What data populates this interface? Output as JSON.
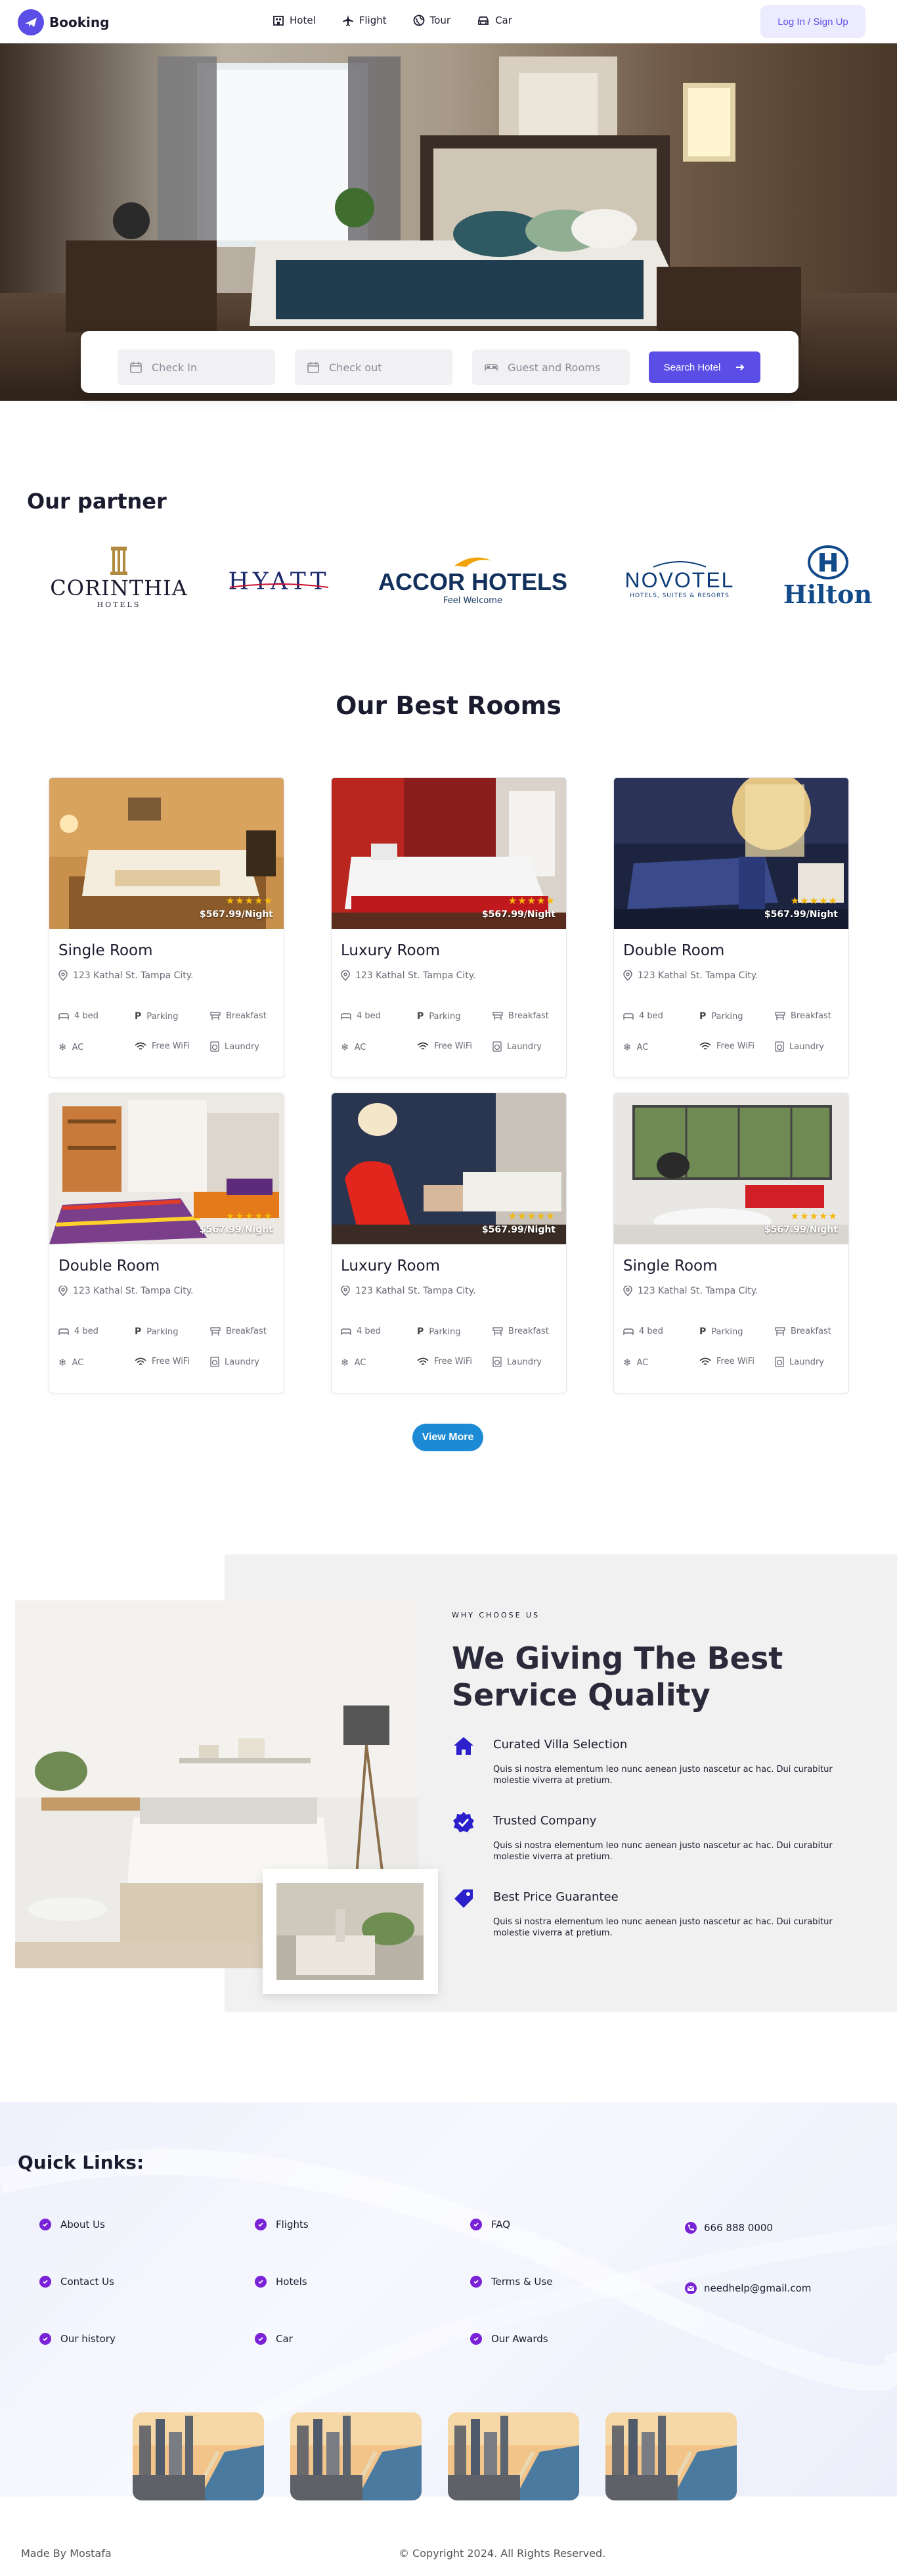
{
  "nav": {
    "brand": "Booking",
    "links": [
      {
        "label": "Hotel",
        "icon": "hotel-icon"
      },
      {
        "label": "Flight",
        "icon": "plane-icon"
      },
      {
        "label": "Tour",
        "icon": "globe-icon"
      },
      {
        "label": "Car",
        "icon": "car-icon"
      }
    ],
    "login_label": "Log In / Sign Up"
  },
  "search": {
    "check_in": "Check In",
    "check_out": "Check out",
    "guests": "Guest and Rooms",
    "button": "Search Hotel"
  },
  "partners": {
    "title": "Our partner",
    "logos": [
      {
        "name": "CORINTHIA",
        "sub": "HOTELS"
      },
      {
        "name": "HYATT",
        "sub": ""
      },
      {
        "name": "ACCOR HOTELS",
        "sub": "Feel Welcome"
      },
      {
        "name": "NOVOTEL",
        "sub": "HOTELS, SUITES & RESORTS"
      },
      {
        "name": "Hilton",
        "sub": ""
      }
    ]
  },
  "rooms": {
    "title": "Our Best Rooms",
    "view_more": "View More",
    "items": [
      {
        "title": "Single Room",
        "price": "$567.99/Night",
        "stars": "★★★★★",
        "address": "123 Kathal St. Tampa City.",
        "amenities": [
          "4 bed",
          "Parking",
          "Breakfast",
          "AC",
          "Free WiFi",
          "Laundry"
        ]
      },
      {
        "title": "Luxury Room",
        "price": "$567.99/Night",
        "stars": "★★★★★",
        "address": "123 Kathal St. Tampa City.",
        "amenities": [
          "4 bed",
          "Parking",
          "Breakfast",
          "AC",
          "Free WiFi",
          "Laundry"
        ]
      },
      {
        "title": "Double Room",
        "price": "$567.99/Night",
        "stars": "★★★★★",
        "address": "123 Kathal St. Tampa City.",
        "amenities": [
          "4 bed",
          "Parking",
          "Breakfast",
          "AC",
          "Free WiFi",
          "Laundry"
        ]
      },
      {
        "title": "Double Room",
        "price": "$567.99/Night",
        "stars": "★★★★★",
        "address": "123 Kathal St. Tampa City.",
        "amenities": [
          "4 bed",
          "Parking",
          "Breakfast",
          "AC",
          "Free WiFi",
          "Laundry"
        ]
      },
      {
        "title": "Luxury Room",
        "price": "$567.99/Night",
        "stars": "★★★★★",
        "address": "123 Kathal St. Tampa City.",
        "amenities": [
          "4 bed",
          "Parking",
          "Breakfast",
          "AC",
          "Free WiFi",
          "Laundry"
        ]
      },
      {
        "title": "Single Room",
        "price": "$567.99/Night",
        "stars": "★★★★★",
        "address": "123 Kathal St. Tampa City.",
        "amenities": [
          "4 bed",
          "Parking",
          "Breakfast",
          "AC",
          "Free WiFi",
          "Laundry"
        ]
      }
    ]
  },
  "why": {
    "kicker": "WHY CHOOSE US",
    "title": "We Giving The Best Service Quality",
    "items": [
      {
        "title": "Curated Villa Selection",
        "desc": "Quis si nostra elementum leo nunc aenean justo nascetur ac hac. Dui curabitur molestie viverra at pretium.",
        "icon": "house-icon"
      },
      {
        "title": "Trusted Company",
        "desc": "Quis si nostra elementum leo nunc aenean justo nascetur ac hac. Dui curabitur molestie viverra at pretium.",
        "icon": "verified-badge-icon"
      },
      {
        "title": "Best Price Guarantee",
        "desc": "Quis si nostra elementum leo nunc aenean justo nascetur ac hac. Dui curabitur molestie viverra at pretium.",
        "icon": "price-tag-icon"
      }
    ]
  },
  "footer": {
    "quick_links_title": "Quick Links:",
    "col1": [
      "About Us",
      "Contact Us",
      "Our history"
    ],
    "col2": [
      "Flights",
      "Hotels",
      "Car"
    ],
    "col3": [
      "FAQ",
      "Terms & Use",
      "Our Awards"
    ],
    "phone": "666 888 0000",
    "email": "needhelp@gmail.com",
    "made_by": "Made By Mostafa",
    "copyright": "© Copyright 2024. All Rights Reserved."
  },
  "colors": {
    "accent": "#5b4ee6",
    "view_more": "#1c8ad4",
    "why_icon": "#2b20c9",
    "check": "#7a22d8",
    "star": "#f5b90d"
  }
}
